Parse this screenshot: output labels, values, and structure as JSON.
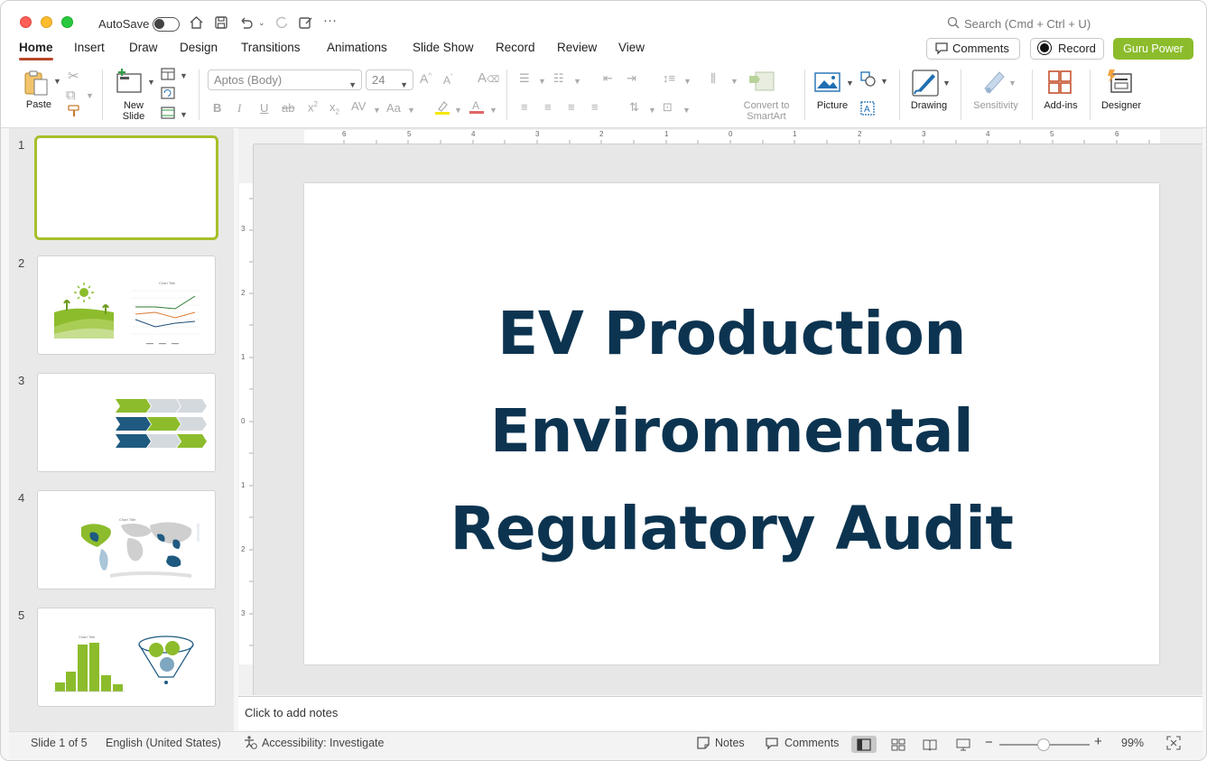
{
  "titlebar": {
    "autosave_label": "AutoSave",
    "search_placeholder": "Search (Cmd + Ctrl + U)"
  },
  "menu": {
    "tabs": [
      "Home",
      "Insert",
      "Draw",
      "Design",
      "Transitions",
      "Animations",
      "Slide Show",
      "Record",
      "Review",
      "View"
    ],
    "active_tab": "Home",
    "comments_label": "Comments",
    "record_label": "Record",
    "guru_label": "Guru Power"
  },
  "ribbon": {
    "paste": "Paste",
    "new_slide_line1": "New",
    "new_slide_line2": "Slide",
    "font_name": "Aptos (Body)",
    "font_size": "24",
    "convert_line1": "Convert to",
    "convert_line2": "SmartArt",
    "picture": "Picture",
    "drawing": "Drawing",
    "sensitivity": "Sensitivity",
    "addins": "Add-ins",
    "designer": "Designer"
  },
  "slides": {
    "numbers": [
      "1",
      "2",
      "3",
      "4",
      "5"
    ],
    "thumb_chart_title": "Chart Title",
    "selected": 1
  },
  "ruler": {
    "h_labels": [
      "6",
      "5",
      "4",
      "3",
      "2",
      "1",
      "0",
      "1",
      "2",
      "3",
      "4",
      "5",
      "6"
    ],
    "v_labels": [
      "3",
      "2",
      "1",
      "0",
      "1",
      "2",
      "3"
    ]
  },
  "slide": {
    "title_line1": "EV Production",
    "title_line2": "Environmental",
    "title_line3": "Regulatory Audit",
    "title_color": "#0c3450"
  },
  "notes_placeholder": "Click to add notes",
  "status": {
    "slide_count": "Slide 1 of 5",
    "language": "English (United States)",
    "accessibility": "Accessibility: Investigate",
    "notes": "Notes",
    "comments": "Comments",
    "zoom": "99%"
  },
  "colors": {
    "accent": "#8cbc2c",
    "tab_underline": "#b7472a",
    "selected_thumb_border": "#a7bf2a"
  }
}
